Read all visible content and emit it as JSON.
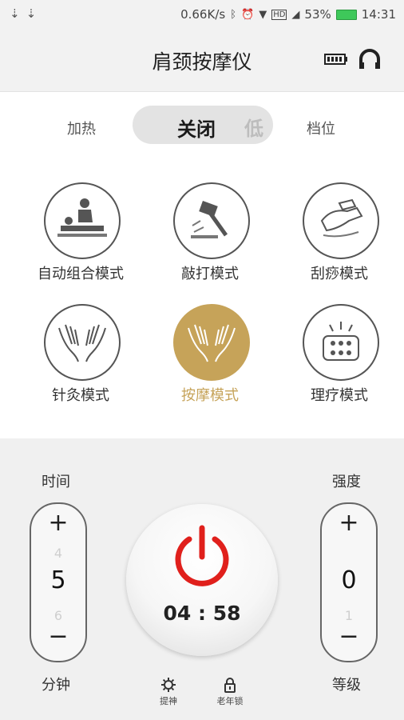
{
  "status_bar": {
    "left_icons": [
      "usb-icon",
      "usb-icon"
    ],
    "speed": "0.66K/s",
    "icons": [
      "bluetooth-icon",
      "alarm-icon",
      "wifi-icon",
      "hd-icon",
      "signal-4g-icon"
    ],
    "battery_percent": "53%",
    "time": "14:31",
    "battery_color": "#3ec85a"
  },
  "header": {
    "title": "肩颈按摩仪",
    "icons": [
      "device-battery-icon",
      "headset-icon"
    ]
  },
  "heat": {
    "left_label": "加热",
    "toggle_on": "关闭",
    "toggle_off": "低",
    "right_label": "档位"
  },
  "modes": [
    {
      "label": "自动组合模式",
      "icon": "massage-bed-icon",
      "active": false
    },
    {
      "label": "敲打模式",
      "icon": "hammer-icon",
      "active": false
    },
    {
      "label": "刮痧模式",
      "icon": "scraping-icon",
      "active": false
    },
    {
      "label": "针灸模式",
      "icon": "acupuncture-hands-icon",
      "active": false
    },
    {
      "label": "按摩模式",
      "icon": "massage-hands-icon",
      "active": true
    },
    {
      "label": "理疗模式",
      "icon": "therapy-pad-icon",
      "active": false
    }
  ],
  "accent_color": "#c6a359",
  "time_control": {
    "title": "时间",
    "plus": "+",
    "prev": "4",
    "value": "5",
    "next": "6",
    "minus": "−",
    "unit": "分钟"
  },
  "intensity_control": {
    "title": "强度",
    "plus": "+",
    "prev": "",
    "value": "0",
    "next": "1",
    "minus": "−",
    "unit": "等级"
  },
  "power": {
    "icon": "power-icon",
    "icon_color": "#e0201c",
    "countdown": "04 : 58"
  },
  "bottom_buttons": [
    {
      "label": "提神",
      "icon": "gear-icon"
    },
    {
      "label": "老年锁",
      "icon": "lock-icon"
    }
  ]
}
